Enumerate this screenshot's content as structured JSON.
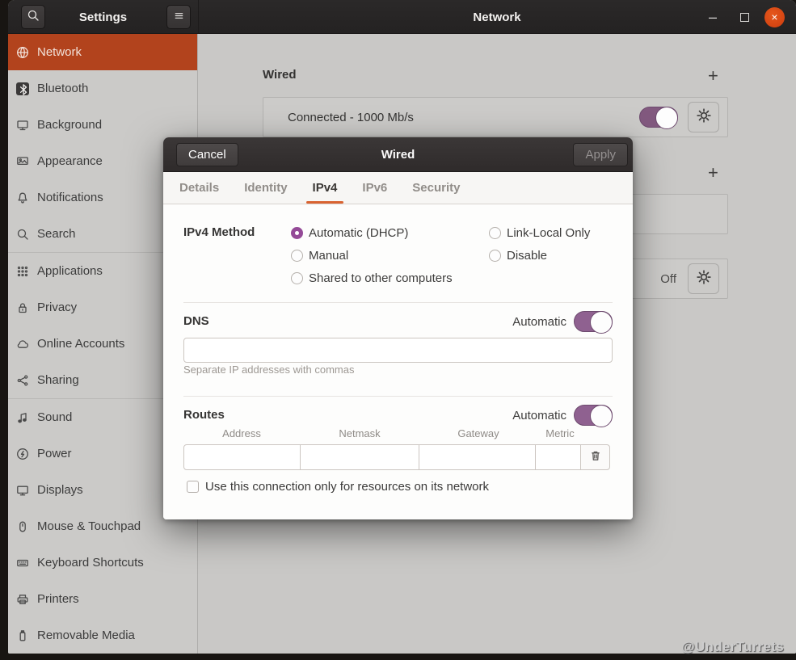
{
  "window": {
    "sidebar_title": "Settings",
    "main_title": "Network",
    "controls": {
      "minimize": "–",
      "close": "×"
    }
  },
  "sidebar": {
    "items": [
      {
        "id": "network",
        "label": "Network",
        "icon": "globe-icon",
        "selected": true
      },
      {
        "id": "bluetooth",
        "label": "Bluetooth",
        "icon": "bluetooth-icon",
        "chip": true
      },
      {
        "id": "background",
        "label": "Background",
        "icon": "background-icon"
      },
      {
        "id": "appearance",
        "label": "Appearance",
        "icon": "appearance-icon"
      },
      {
        "id": "notifications",
        "label": "Notifications",
        "icon": "bell-icon"
      },
      {
        "id": "search",
        "label": "Search",
        "icon": "search-icon",
        "separator_after": true
      },
      {
        "id": "applications",
        "label": "Applications",
        "icon": "grid-icon"
      },
      {
        "id": "privacy",
        "label": "Privacy",
        "icon": "lock-icon"
      },
      {
        "id": "online-accounts",
        "label": "Online Accounts",
        "icon": "cloud-icon"
      },
      {
        "id": "sharing",
        "label": "Sharing",
        "icon": "share-icon",
        "separator_after": true
      },
      {
        "id": "sound",
        "label": "Sound",
        "icon": "note-icon"
      },
      {
        "id": "power",
        "label": "Power",
        "icon": "power-icon"
      },
      {
        "id": "displays",
        "label": "Displays",
        "icon": "display-icon"
      },
      {
        "id": "mouse-touchpad",
        "label": "Mouse & Touchpad",
        "icon": "mouse-icon"
      },
      {
        "id": "keyboard-shortcuts",
        "label": "Keyboard Shortcuts",
        "icon": "keyboard-icon"
      },
      {
        "id": "printers",
        "label": "Printers",
        "icon": "printer-icon"
      },
      {
        "id": "removable-media",
        "label": "Removable Media",
        "icon": "media-icon"
      }
    ]
  },
  "main": {
    "wired_section_title": "Wired",
    "add_button": "+",
    "connection_status": "Connected - 1000 Mb/s",
    "connection_toggle_on": true,
    "proxy_status": "Off"
  },
  "dialog": {
    "title": "Wired",
    "cancel_label": "Cancel",
    "apply_label": "Apply",
    "apply_enabled": false,
    "tabs": [
      {
        "label": "Details",
        "active": false
      },
      {
        "label": "Identity",
        "active": false
      },
      {
        "label": "IPv4",
        "active": true
      },
      {
        "label": "IPv6",
        "active": false
      },
      {
        "label": "Security",
        "active": false
      }
    ],
    "ipv4_method": {
      "label": "IPv4 Method",
      "options": [
        {
          "label": "Automatic (DHCP)",
          "selected": true,
          "column": 1
        },
        {
          "label": "Manual",
          "selected": false,
          "column": 1
        },
        {
          "label": "Shared to other computers",
          "selected": false,
          "column": 1
        },
        {
          "label": "Link-Local Only",
          "selected": false,
          "column": 2
        },
        {
          "label": "Disable",
          "selected": false,
          "column": 2
        }
      ]
    },
    "dns": {
      "label": "DNS",
      "automatic_label": "Automatic",
      "enabled": true,
      "value": "",
      "hint": "Separate IP addresses with commas"
    },
    "routes": {
      "label": "Routes",
      "automatic_label": "Automatic",
      "enabled": true,
      "columns": [
        "Address",
        "Netmask",
        "Gateway",
        "Metric"
      ],
      "row_values": [
        "",
        "",
        "",
        ""
      ]
    },
    "restrict_checkbox": {
      "label": "Use this connection only for resources on its network",
      "checked": false
    }
  },
  "watermark": "@UnderTurrets",
  "colors": {
    "titlebar": "#272525",
    "sidebar_selected_orange": "#b2431d",
    "tab_underline_orange": "#d96331",
    "toggle_purple": "#8f6190",
    "radio_purple": "#944a97",
    "close_button_orange": "#dc4612"
  }
}
